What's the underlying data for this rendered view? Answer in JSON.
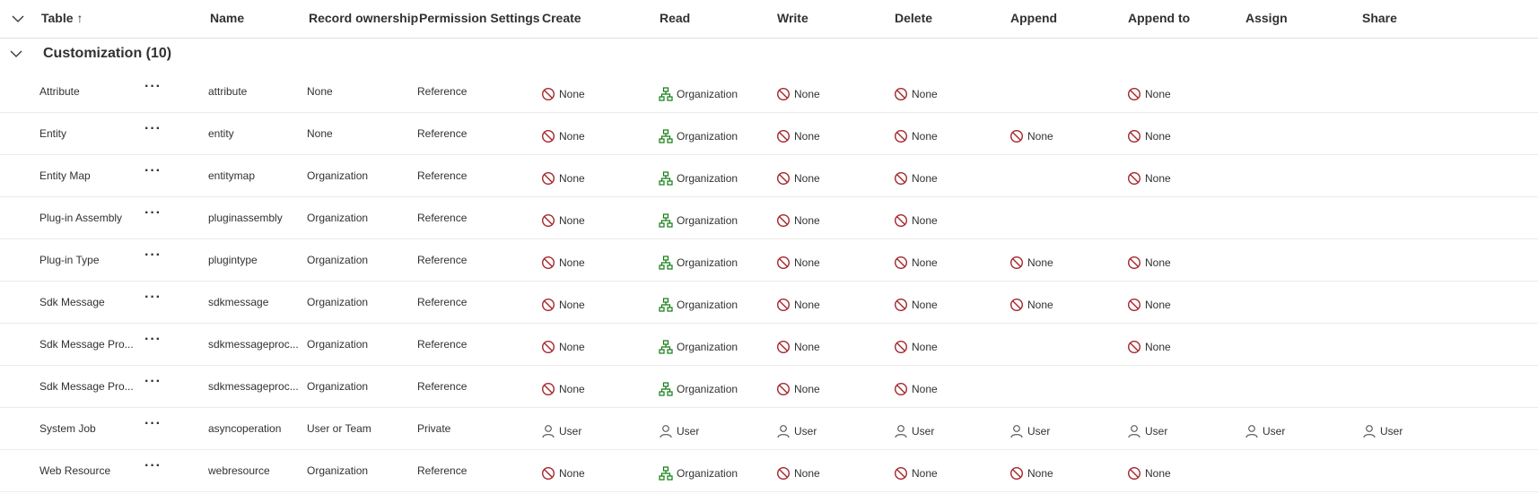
{
  "header": {
    "columns": [
      {
        "key": "table",
        "label": "Table"
      },
      {
        "key": "name",
        "label": "Name"
      },
      {
        "key": "ownership",
        "label": "Record ownership"
      },
      {
        "key": "perm",
        "label": "Permission Settings"
      },
      {
        "key": "create",
        "label": "Create"
      },
      {
        "key": "read",
        "label": "Read"
      },
      {
        "key": "write",
        "label": "Write"
      },
      {
        "key": "delete",
        "label": "Delete"
      },
      {
        "key": "append",
        "label": "Append"
      },
      {
        "key": "appendto",
        "label": "Append to"
      },
      {
        "key": "assign",
        "label": "Assign"
      },
      {
        "key": "share",
        "label": "Share"
      }
    ],
    "sort_icon": "↑"
  },
  "group": {
    "title": "Customization (10)"
  },
  "more_label": "···",
  "icons": {
    "none": "prohibited-icon",
    "org": "org-hierarchy-icon",
    "user": "person-icon"
  },
  "colors": {
    "none": "#a4262c",
    "org": "#107c10",
    "user": "#605e5c"
  },
  "rows": [
    {
      "table": "Attribute",
      "name": "attribute",
      "ownership": "None",
      "perm": "Reference",
      "privileges": {
        "create": "None",
        "read": "Organization",
        "write": "None",
        "delete": "None",
        "append": "",
        "appendto": "None",
        "assign": "",
        "share": ""
      }
    },
    {
      "table": "Entity",
      "name": "entity",
      "ownership": "None",
      "perm": "Reference",
      "privileges": {
        "create": "None",
        "read": "Organization",
        "write": "None",
        "delete": "None",
        "append": "None",
        "appendto": "None",
        "assign": "",
        "share": ""
      }
    },
    {
      "table": "Entity Map",
      "name": "entitymap",
      "ownership": "Organization",
      "perm": "Reference",
      "privileges": {
        "create": "None",
        "read": "Organization",
        "write": "None",
        "delete": "None",
        "append": "",
        "appendto": "None",
        "assign": "",
        "share": ""
      }
    },
    {
      "table": "Plug-in Assembly",
      "name": "pluginassembly",
      "ownership": "Organization",
      "perm": "Reference",
      "privileges": {
        "create": "None",
        "read": "Organization",
        "write": "None",
        "delete": "None",
        "append": "",
        "appendto": "",
        "assign": "",
        "share": ""
      }
    },
    {
      "table": "Plug-in Type",
      "name": "plugintype",
      "ownership": "Organization",
      "perm": "Reference",
      "privileges": {
        "create": "None",
        "read": "Organization",
        "write": "None",
        "delete": "None",
        "append": "None",
        "appendto": "None",
        "assign": "",
        "share": ""
      }
    },
    {
      "table": "Sdk Message",
      "name": "sdkmessage",
      "ownership": "Organization",
      "perm": "Reference",
      "privileges": {
        "create": "None",
        "read": "Organization",
        "write": "None",
        "delete": "None",
        "append": "None",
        "appendto": "None",
        "assign": "",
        "share": ""
      }
    },
    {
      "table": "Sdk Message Pro...",
      "name": "sdkmessageproc...",
      "ownership": "Organization",
      "perm": "Reference",
      "privileges": {
        "create": "None",
        "read": "Organization",
        "write": "None",
        "delete": "None",
        "append": "",
        "appendto": "None",
        "assign": "",
        "share": ""
      }
    },
    {
      "table": "Sdk Message Pro...",
      "name": "sdkmessageproc...",
      "ownership": "Organization",
      "perm": "Reference",
      "privileges": {
        "create": "None",
        "read": "Organization",
        "write": "None",
        "delete": "None",
        "append": "",
        "appendto": "",
        "assign": "",
        "share": ""
      }
    },
    {
      "table": "System Job",
      "name": "asyncoperation",
      "ownership": "User or Team",
      "perm": "Private",
      "privileges": {
        "create": "User",
        "read": "User",
        "write": "User",
        "delete": "User",
        "append": "User",
        "appendto": "User",
        "assign": "User",
        "share": "User"
      }
    },
    {
      "table": "Web Resource",
      "name": "webresource",
      "ownership": "Organization",
      "perm": "Reference",
      "privileges": {
        "create": "None",
        "read": "Organization",
        "write": "None",
        "delete": "None",
        "append": "None",
        "appendto": "None",
        "assign": "",
        "share": ""
      }
    }
  ]
}
